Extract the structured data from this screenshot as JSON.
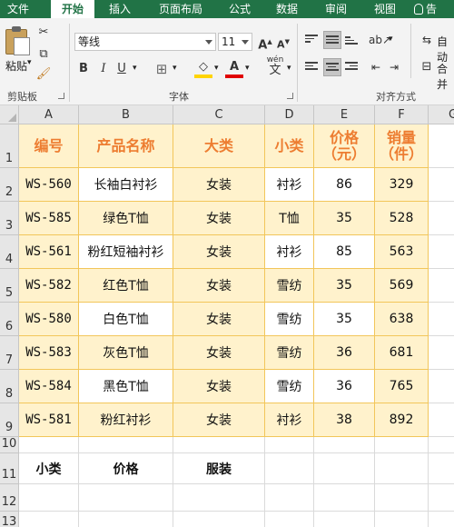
{
  "tabs": [
    "文件",
    "开始",
    "插入",
    "页面布局",
    "公式",
    "数据",
    "审阅",
    "视图"
  ],
  "tell_me": "告",
  "ribbon": {
    "paste_label": "粘贴",
    "clipboard_label": "剪贴板",
    "font_name": "等线",
    "font_size": "11",
    "grow_font": "A",
    "shrink_font": "A",
    "bold": "B",
    "italic": "I",
    "underline": "U",
    "font_group_label": "字体",
    "wen_label": "wén",
    "wen_char": "文",
    "wrap_text": "自动",
    "merge": "合并",
    "align_group_label": "对齐方式"
  },
  "columns": [
    "A",
    "B",
    "C",
    "D",
    "E",
    "F",
    "G"
  ],
  "rows": [
    "1",
    "2",
    "3",
    "4",
    "5",
    "6",
    "7",
    "8",
    "9",
    "10",
    "11",
    "12",
    "13"
  ],
  "table": {
    "headers": [
      "编号",
      "产品名称",
      "大类",
      "小类",
      "价格（元）",
      "销量（件）"
    ],
    "header_lines": {
      "price": [
        "价格",
        "（元）"
      ],
      "sales": [
        "销量",
        "（件）"
      ]
    },
    "rows": [
      [
        "WS-560",
        "长袖白衬衫",
        "女装",
        "衬衫",
        "86",
        "329"
      ],
      [
        "WS-585",
        "绿色T恤",
        "女装",
        "T恤",
        "35",
        "528"
      ],
      [
        "WS-561",
        "粉红短袖衬衫",
        "女装",
        "衬衫",
        "85",
        "563"
      ],
      [
        "WS-582",
        "红色T恤",
        "女装",
        "雪纺",
        "35",
        "569"
      ],
      [
        "WS-580",
        "白色T恤",
        "女装",
        "雪纺",
        "35",
        "638"
      ],
      [
        "WS-583",
        "灰色T恤",
        "女装",
        "雪纺",
        "36",
        "681"
      ],
      [
        "WS-584",
        "黑色T恤",
        "女装",
        "雪纺",
        "36",
        "765"
      ],
      [
        "WS-581",
        "粉红衬衫",
        "女装",
        "衬衫",
        "38",
        "892"
      ]
    ]
  },
  "criteria": {
    "a11": "小类",
    "b11": "价格",
    "c11": "服装"
  },
  "colors": {
    "excel_green": "#217346",
    "table_fill": "#fff2cc",
    "table_border": "#f2c65a",
    "header_text": "#ed7d31"
  }
}
